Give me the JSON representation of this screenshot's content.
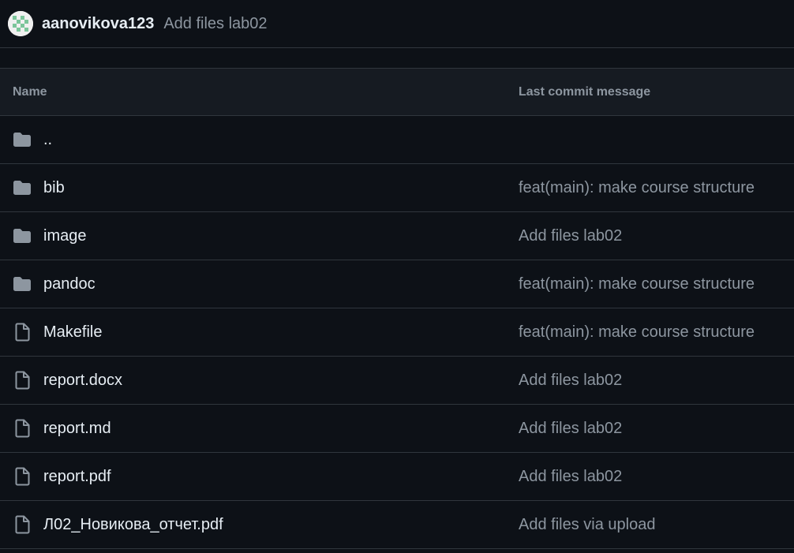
{
  "commit": {
    "author": "aanovikova123",
    "message": "Add files lab02"
  },
  "table": {
    "headers": {
      "name": "Name",
      "message": "Last commit message"
    },
    "rows": [
      {
        "icon": "folder-icon",
        "name": "..",
        "message": ""
      },
      {
        "icon": "folder-icon",
        "name": "bib",
        "message": "feat(main): make course structure"
      },
      {
        "icon": "folder-icon",
        "name": "image",
        "message": "Add files lab02"
      },
      {
        "icon": "folder-icon",
        "name": "pandoc",
        "message": "feat(main): make course structure"
      },
      {
        "icon": "file-icon",
        "name": "Makefile",
        "message": "feat(main): make course structure"
      },
      {
        "icon": "file-icon",
        "name": "report.docx",
        "message": "Add files lab02"
      },
      {
        "icon": "file-icon",
        "name": "report.md",
        "message": "Add files lab02"
      },
      {
        "icon": "file-icon",
        "name": "report.pdf",
        "message": "Add files lab02"
      },
      {
        "icon": "file-icon",
        "name": "Л02_Новикова_отчет.pdf",
        "message": "Add files via upload"
      }
    ]
  },
  "colors": {
    "background": "#0d1117",
    "header_background": "#161b22",
    "border": "#30363d",
    "text_primary": "#e6edf3",
    "text_muted": "#8d96a0",
    "icon": "#8d96a0",
    "avatar_accent": "#3fb950"
  }
}
